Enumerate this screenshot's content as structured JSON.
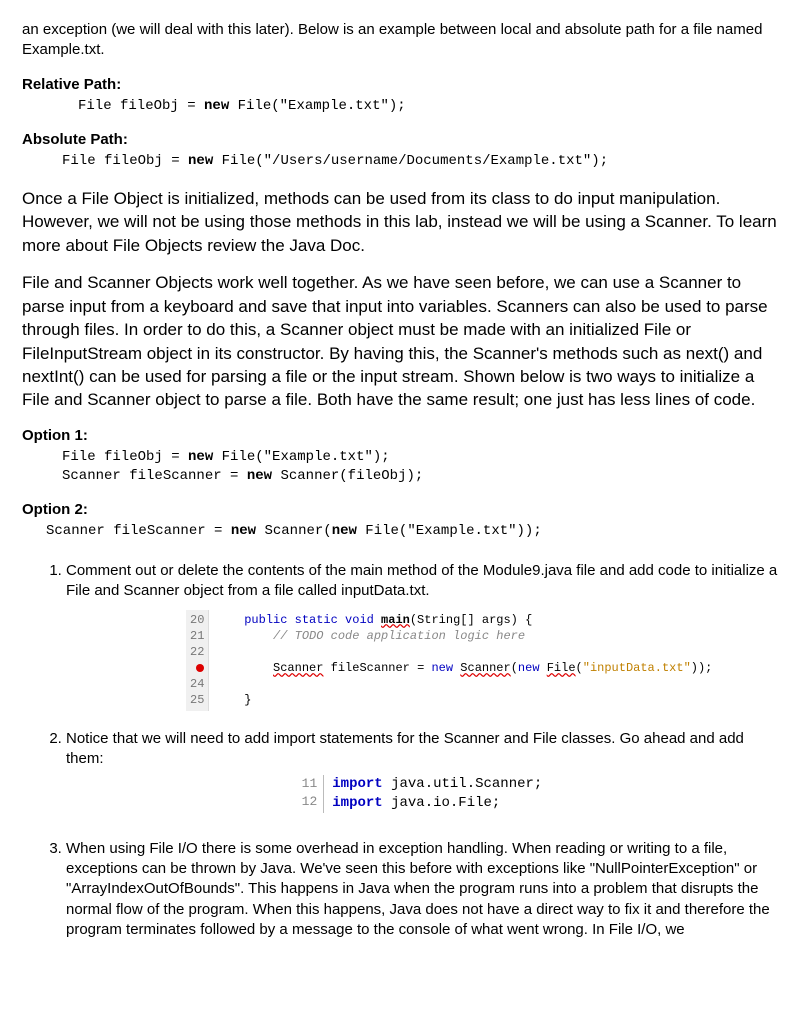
{
  "intro": "an exception (we will deal with this later). Below is an example between local and absolute path for a file named Example.txt.",
  "relPath": {
    "label": "Relative Path:",
    "pre": "File fileObj = ",
    "kw": "new",
    "post": " File(\"Example.txt\");"
  },
  "absPath": {
    "label": "Absolute Path:",
    "pre": "File fileObj = ",
    "kw": "new",
    "post": " File(\"/Users/username/Documents/Example.txt\");"
  },
  "para2": "Once a File Object is initialized, methods can be used from its class to do input manipulation. However, we will not be using those methods in this lab, instead we will be using a Scanner. To learn more about File Objects review the Java Doc.",
  "para3": "File and Scanner Objects work well together. As we have seen before, we can use a Scanner to parse input from a keyboard and save that input into variables. Scanners can also be used to parse through files. In order to do this, a Scanner object must be made with an initialized File or FileInputStream object in its constructor. By having this, the Scanner's methods such as next() and nextInt() can be used for parsing a file or the input stream. Shown below is two ways to initialize a File and Scanner object to parse a file. Both have the same result; one just has less lines of code.",
  "opt1": {
    "label": "Option 1:",
    "l1a": "File fileObj = ",
    "l1kw": "new",
    "l1b": " File(\"Example.txt\");",
    "l2a": "Scanner fileScanner = ",
    "l2kw": "new",
    "l2b": " Scanner(fileObj);"
  },
  "opt2": {
    "label": "Option 2:",
    "a": "Scanner fileScanner = ",
    "kw1": "new",
    "b": " Scanner(",
    "kw2": "new",
    "c": " File(\"Example.txt\"));"
  },
  "steps": {
    "s1": "Comment out or delete the contents of the main method of the Module9.java file and add code to initialize a File and Scanner object from a file called inputData.txt.",
    "s2": "Notice that we will need to add import statements for the Scanner and File classes. Go ahead and add them:",
    "s3": "When using File I/O there is some overhead in exception handling. When reading or writing to a file, exceptions can be thrown by Java. We've seen this before with exceptions like \"NullPointerException\" or \"ArrayIndexOutOfBounds\". This happens in Java when the program runs into a problem that disrupts the normal flow of the program. When this happens, Java does not have a direct way to fix it and therefore the program terminates followed by a message to the console of what went wrong. In File I/O, we"
  },
  "code1": {
    "lines": [
      "20",
      "21",
      "22",
      "  ",
      "24",
      "25"
    ],
    "l20_a": "public static void ",
    "l20_b": "main",
    "l20_c": "(String[] args) {",
    "l21": "    // TODO code application logic here",
    "l22": "",
    "l23_a": "    ",
    "l23_b": "Scanner",
    "l23_c": " fileScanner = ",
    "l23_d": "new",
    "l23_e": " ",
    "l23_f": "Scanner",
    "l23_g": "(",
    "l23_h": "new",
    "l23_i": " ",
    "l23_j": "File",
    "l23_k": "(",
    "l23_str": "\"inputData.txt\"",
    "l23_l": "));",
    "l24": "",
    "l25": "}"
  },
  "code2": {
    "ln1": "11",
    "ln2": "12",
    "kw": "import",
    "l1": " java.util.Scanner;",
    "l2": " java.io.File;"
  }
}
